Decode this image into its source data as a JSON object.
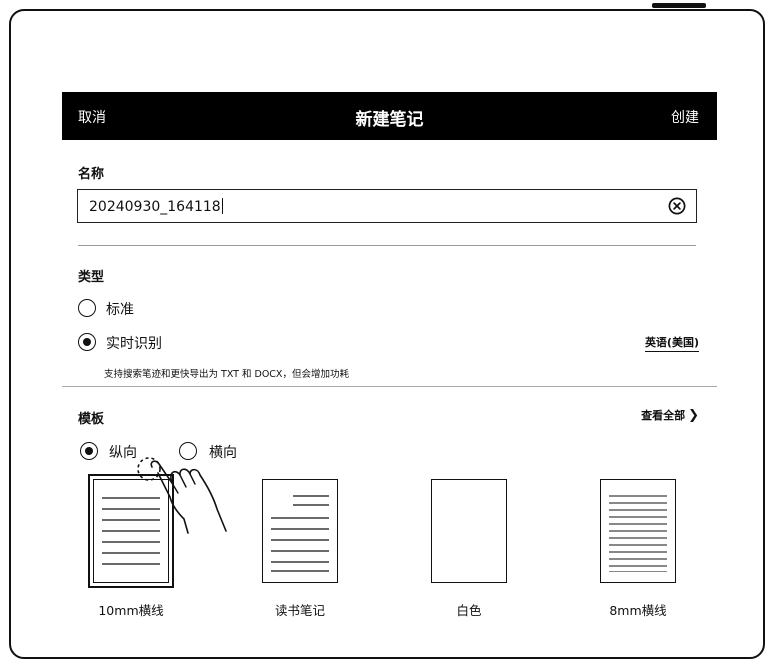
{
  "dialog": {
    "cancel_label": "取消",
    "title": "新建笔记",
    "create_label": "创建"
  },
  "name_section": {
    "label": "名称",
    "value": "20240930_164118"
  },
  "type_section": {
    "label": "类型",
    "options": [
      {
        "label": "标准",
        "selected": false
      },
      {
        "label": "实时识别",
        "selected": true
      }
    ],
    "language": "英语(美国)",
    "description": "支持搜索笔迹和更快导出为 TXT 和 DOCX，但会增加功耗"
  },
  "template_section": {
    "label": "模板",
    "view_all": "查看全部",
    "orientations": [
      {
        "label": "纵向",
        "selected": true
      },
      {
        "label": "横向",
        "selected": false
      }
    ],
    "templates": [
      {
        "label": "10mm横线",
        "selected": true
      },
      {
        "label": "读书笔记",
        "selected": false
      },
      {
        "label": "白色",
        "selected": false
      },
      {
        "label": "8mm横线",
        "selected": false
      }
    ]
  },
  "icons": [
    "clear-icon",
    "chevron-right-icon",
    "tap-hand-icon"
  ]
}
